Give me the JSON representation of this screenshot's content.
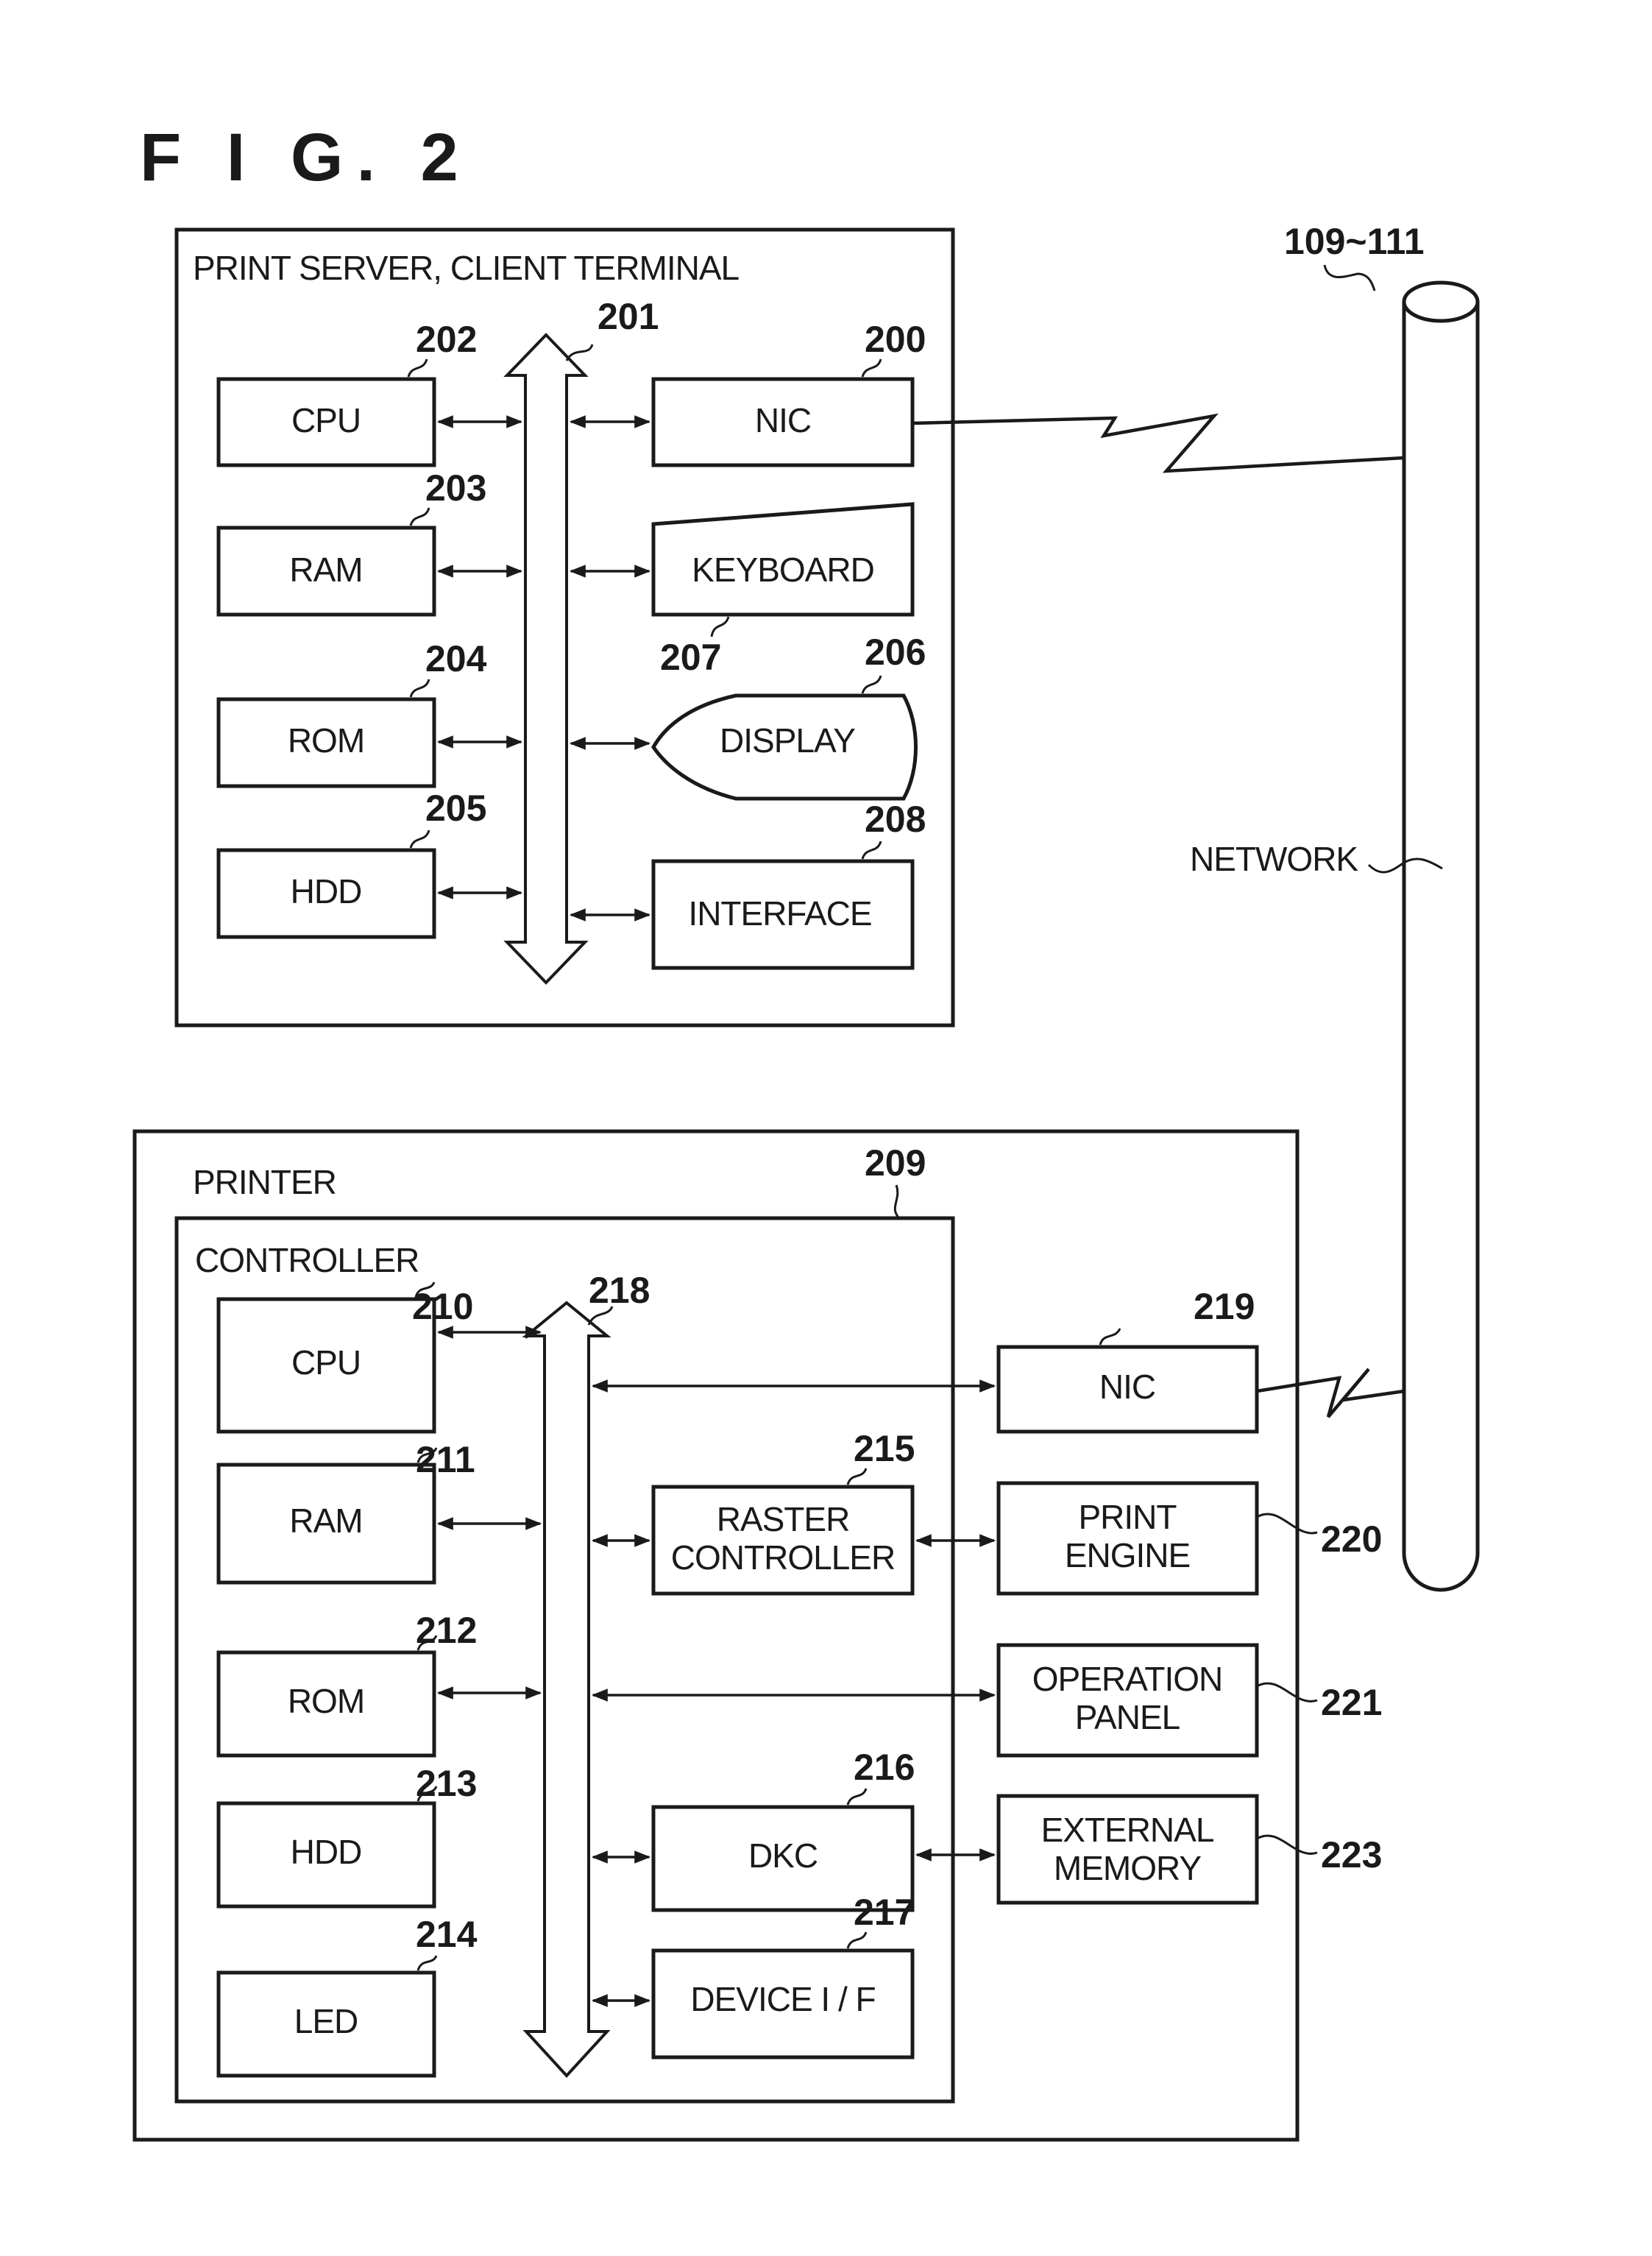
{
  "figure": {
    "title": "F I G. 2"
  },
  "network": {
    "ref": "109~111",
    "label": "NETWORK"
  },
  "server": {
    "title": "PRINT SERVER, CLIENT TERMINAL",
    "bus_ref": "201",
    "blocks": {
      "cpu": {
        "label": "CPU",
        "ref": "202"
      },
      "ram": {
        "label": "RAM",
        "ref": "203"
      },
      "rom": {
        "label": "ROM",
        "ref": "204"
      },
      "hdd": {
        "label": "HDD",
        "ref": "205"
      },
      "nic": {
        "label": "NIC",
        "ref": "200"
      },
      "keyboard": {
        "label": "KEYBOARD",
        "ref": "207"
      },
      "display": {
        "label": "DISPLAY",
        "ref": "206"
      },
      "interface": {
        "label": "INTERFACE",
        "ref": "208"
      }
    }
  },
  "printer": {
    "title": "PRINTER",
    "controller": {
      "title": "CONTROLLER",
      "ref": "209",
      "bus_ref": "218",
      "blocks": {
        "cpu": {
          "label": "CPU",
          "ref": "210"
        },
        "ram": {
          "label": "RAM",
          "ref": "211"
        },
        "rom": {
          "label": "ROM",
          "ref": "212"
        },
        "hdd": {
          "label": "HDD",
          "ref": "213"
        },
        "led": {
          "label": "LED",
          "ref": "214"
        },
        "raster": {
          "label_line1": "RASTER",
          "label_line2": "CONTROLLER",
          "ref": "215"
        },
        "dkc": {
          "label": "DKC",
          "ref": "216"
        },
        "device_if": {
          "label": "DEVICE I / F",
          "ref": "217"
        }
      }
    },
    "blocks": {
      "nic": {
        "label": "NIC",
        "ref": "219"
      },
      "print_engine": {
        "label_line1": "PRINT",
        "label_line2": "ENGINE",
        "ref": "220"
      },
      "operation_panel": {
        "label_line1": "OPERATION",
        "label_line2": "PANEL",
        "ref": "221"
      },
      "external_memory": {
        "label_line1": "EXTERNAL",
        "label_line2": "MEMORY",
        "ref": "223"
      }
    }
  }
}
